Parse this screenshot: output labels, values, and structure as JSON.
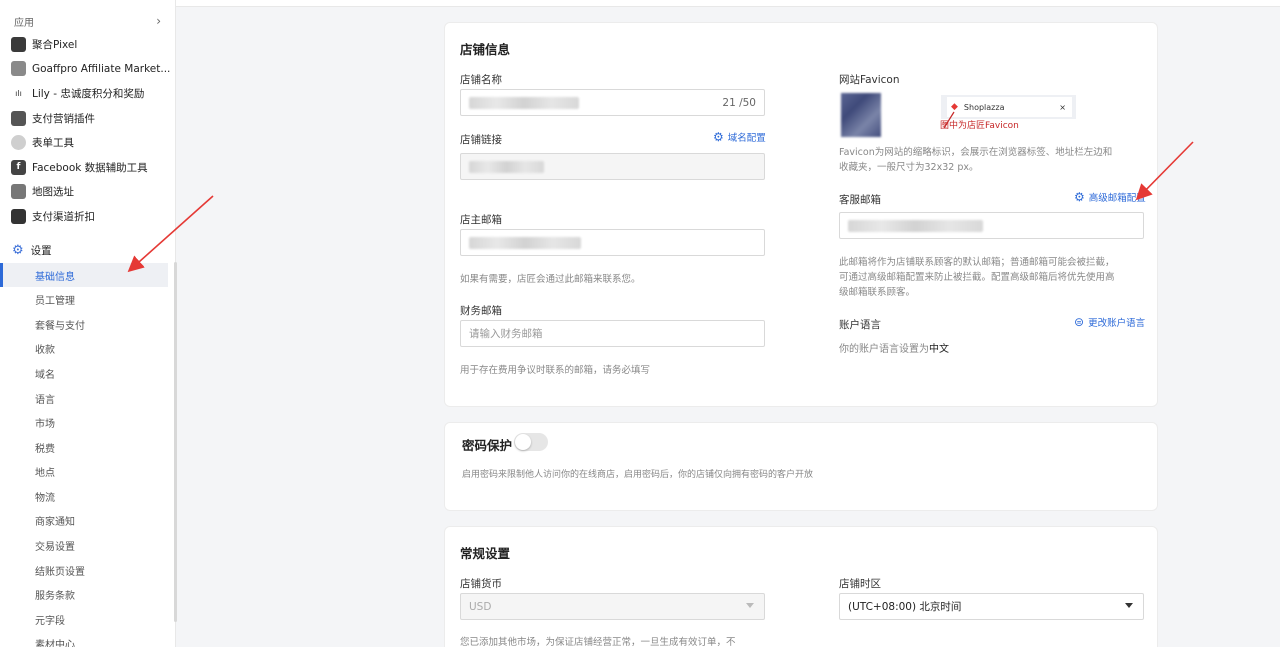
{
  "sidebar": {
    "apps_header": "应用",
    "apps": [
      {
        "label": "聚合Pixel",
        "icon": "pixel-icon",
        "color": "#3a3a3a"
      },
      {
        "label": "Goaffpro Affiliate Market...",
        "icon": "goaffpro-icon",
        "color": "#8a8a8a"
      },
      {
        "label": "Lily - 忠诚度积分和奖励",
        "icon": "lily-icon",
        "color": "#ffffff"
      },
      {
        "label": "支付营销插件",
        "icon": "payment-plugin-icon",
        "color": "#555555"
      },
      {
        "label": "表单工具",
        "icon": "form-tool-icon",
        "color": "#cfcfcf"
      },
      {
        "label": "Facebook 数据辅助工具",
        "icon": "facebook-icon",
        "color": "#444444"
      },
      {
        "label": "地图选址",
        "icon": "map-icon",
        "color": "#777777"
      },
      {
        "label": "支付渠道折扣",
        "icon": "discount-icon",
        "color": "#333333"
      }
    ],
    "settings_label": "设置",
    "settings_items": [
      "基础信息",
      "员工管理",
      "套餐与支付",
      "收款",
      "域名",
      "语言",
      "市场",
      "税费",
      "地点",
      "物流",
      "商家通知",
      "交易设置",
      "结账页设置",
      "服务条款",
      "元字段",
      "素材中心"
    ],
    "active_item": "基础信息"
  },
  "store_info": {
    "title": "店铺信息",
    "store_name_label": "店铺名称",
    "store_name_counter": "21 /50",
    "store_link_label": "店铺链接",
    "domain_config_link": "域名配置",
    "owner_email_label": "店主邮箱",
    "owner_email_help": "如果有需要，店匠会通过此邮箱来联系您。",
    "finance_email_label": "财务邮箱",
    "finance_email_placeholder": "请输入财务邮箱",
    "finance_email_help": "用于存在费用争议时联系的邮箱，请务必填写",
    "favicon_label": "网站Favicon",
    "favicon_preview_tab": "Shoplazza",
    "favicon_preview_close": "×",
    "favicon_annotation": "图中为店匠Favicon",
    "favicon_help_1": "Favicon为网站的缩略标识，会展示在浏览器标签、地址栏左边和",
    "favicon_help_2": "收藏夹，一般尺寸为32x32 px。",
    "service_email_label": "客服邮箱",
    "advanced_email_link": "高级邮箱配置",
    "service_email_help_1": "此邮箱将作为店铺联系顾客的默认邮箱；普通邮箱可能会被拦截，",
    "service_email_help_2": "可通过高级邮箱配置来防止被拦截。配置高级邮箱后将优先使用高",
    "service_email_help_3": "级邮箱联系顾客。",
    "account_lang_label": "账户语言",
    "change_lang_link": "更改账户语言",
    "account_lang_text": "你的账户语言设置为",
    "account_lang_value": "中文"
  },
  "password": {
    "title": "密码保护",
    "enabled": false,
    "help": "启用密码来限制他人访问你的在线商店，启用密码后，你的店铺仅向拥有密码的客户开放"
  },
  "general": {
    "title": "常规设置",
    "currency_label": "店铺货币",
    "currency_value": "USD",
    "timezone_label": "店铺时区",
    "timezone_value": "(UTC+08:00) 北京时间",
    "currency_help": "您已添加其他市场，为保证店铺经营正常，一旦生成有效订单，不"
  },
  "colors": {
    "accent": "#2d6ad8",
    "annotation": "#e53935"
  }
}
